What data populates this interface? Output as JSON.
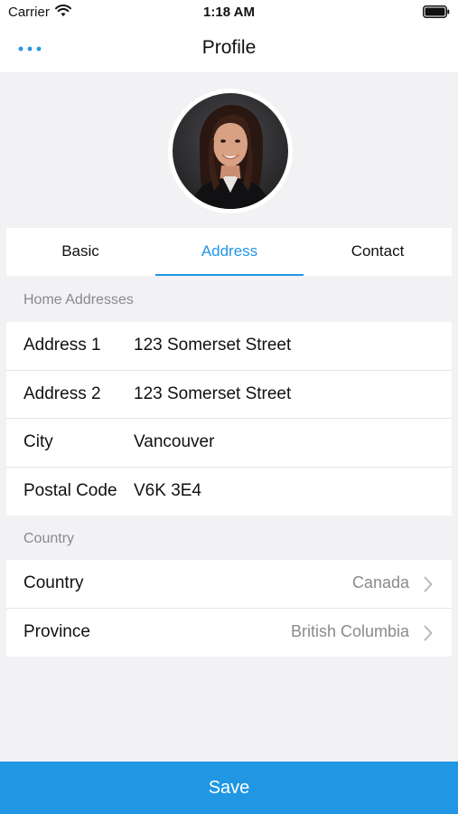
{
  "status_bar": {
    "carrier": "Carrier",
    "time": "1:18 AM",
    "wifi_icon": "wifi-icon",
    "battery_icon": "battery-icon"
  },
  "nav": {
    "title": "Profile",
    "more_icon": "more-horizontal-icon"
  },
  "tabs": [
    {
      "label": "Basic",
      "active": false
    },
    {
      "label": "Address",
      "active": true
    },
    {
      "label": "Contact",
      "active": false
    }
  ],
  "home_addresses": {
    "header": "Home Addresses",
    "rows": [
      {
        "label": "Address 1",
        "value": "123 Somerset Street"
      },
      {
        "label": "Address 2",
        "value": "123 Somerset Street"
      },
      {
        "label": "City",
        "value": "Vancouver"
      },
      {
        "label": "Postal Code",
        "value": "V6K 3E4"
      }
    ]
  },
  "country_section": {
    "header": "Country",
    "rows": [
      {
        "label": "Country",
        "value": "Canada"
      },
      {
        "label": "Province",
        "value": "British Columbia"
      }
    ]
  },
  "save_label": "Save",
  "colors": {
    "accent": "#2196e3",
    "background": "#f2f2f4",
    "secondary_text": "#8a8a8e"
  }
}
